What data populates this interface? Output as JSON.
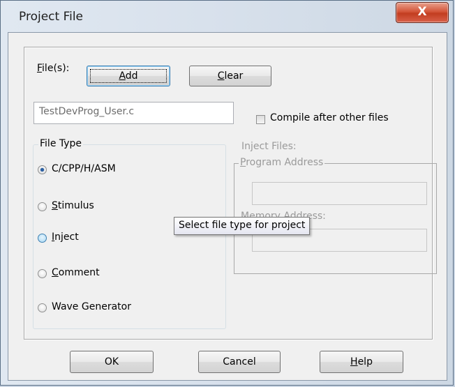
{
  "window": {
    "title": "Project File",
    "close_glyph": "X"
  },
  "files": {
    "label_mnemonic": "F",
    "label_rest": "ile(s):",
    "add_mnemonic": "A",
    "add_rest": "dd",
    "clear_mnemonic": "C",
    "clear_rest": "lear",
    "current_file": "TestDevProg_User.c",
    "compile_after": {
      "label": "Compile after other files",
      "checked": false
    }
  },
  "file_type": {
    "legend": "File Type",
    "options": [
      {
        "pre": "",
        "mnemonic": "",
        "rest": "C/CPP/H/ASM",
        "checked": true
      },
      {
        "pre": "",
        "mnemonic": "S",
        "rest": "timulus",
        "checked": false
      },
      {
        "pre": "",
        "mnemonic": "I",
        "rest": "nject",
        "checked": false
      },
      {
        "pre": "",
        "mnemonic": "C",
        "rest": "omment",
        "checked": false
      },
      {
        "pre": "",
        "mnemonic": "",
        "rest": "Wave Generator",
        "checked": false
      }
    ]
  },
  "inject": {
    "heading": "Inject Files:",
    "program_address_mnemonic": "P",
    "program_address_rest": "rogram Address",
    "program_address_value": "",
    "memory_address_mnemonic": "M",
    "memory_address_rest": "emory Address:",
    "memory_address_value": ""
  },
  "tooltip": "Select file type for project",
  "footer": {
    "ok": "OK",
    "cancel": "Cancel",
    "help_mnemonic": "H",
    "help_rest": "elp"
  }
}
